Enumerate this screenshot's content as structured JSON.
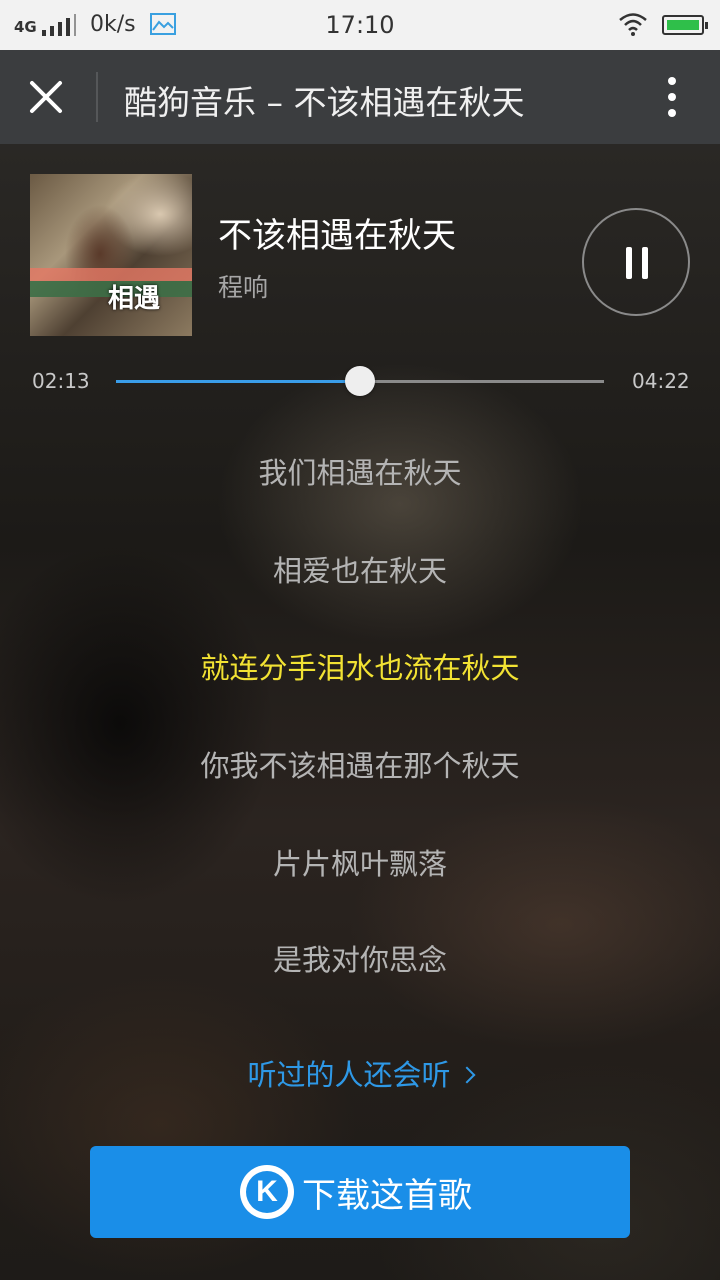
{
  "status_bar": {
    "signal_label": "4G",
    "net_speed": "0k/s",
    "time": "17:10",
    "icons": [
      "signal-icon",
      "image-icon",
      "wifi-icon",
      "battery-icon"
    ]
  },
  "header": {
    "title": "酷狗音乐 – 不该相遇在秋天",
    "icons": [
      "close-icon",
      "more-vertical-icon"
    ]
  },
  "song": {
    "title": "不该相遇在秋天",
    "artist": "程响",
    "cover_text": "相遇"
  },
  "player": {
    "current_time": "02:13",
    "total_time": "04:22",
    "progress": 0.5,
    "state": "playing",
    "accent_color": "#3a9de8"
  },
  "lyrics": [
    {
      "text": "我们相遇在秋天",
      "active": false
    },
    {
      "text": "相爱也在秋天",
      "active": false
    },
    {
      "text": "就连分手泪水也流在秋天",
      "active": true
    },
    {
      "text": "你我不该相遇在那个秋天",
      "active": false
    },
    {
      "text": "片片枫叶飘落",
      "active": false
    },
    {
      "text": "是我对你思念",
      "active": false
    }
  ],
  "related_link": "听过的人还会听",
  "download": {
    "label": "下载这首歌",
    "icon_letter": "K",
    "color": "#1a8ee8"
  }
}
